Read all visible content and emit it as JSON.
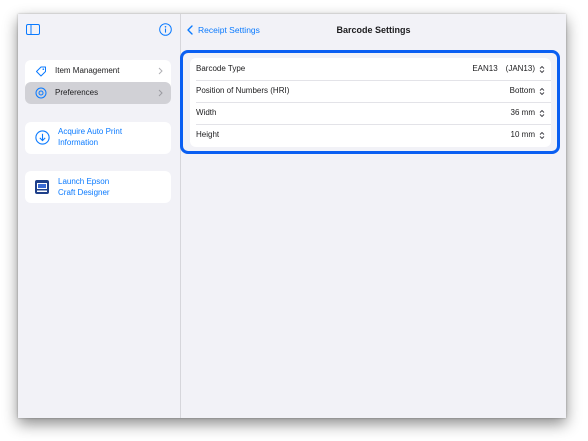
{
  "sidebar": {
    "toggle_icon": "sidebar-toggle-icon",
    "info_icon": "info-icon",
    "menu": [
      {
        "label": "Item Management",
        "icon": "tag-icon",
        "selected": false
      },
      {
        "label": "Preferences",
        "icon": "gear-circle-icon",
        "selected": true
      }
    ],
    "actions": [
      {
        "label_line1": "Acquire Auto Print",
        "label_line2": "Information",
        "icon": "download-circle-icon"
      },
      {
        "label_line1": "Launch Epson",
        "label_line2": "Craft Designer",
        "icon": "epson-app-icon"
      }
    ]
  },
  "nav": {
    "back_label": "Receipt Settings",
    "title": "Barcode Settings"
  },
  "settings": [
    {
      "label": "Barcode Type",
      "value": "EAN13　(JAN13)"
    },
    {
      "label": "Position of Numbers (HRI)",
      "value": "Bottom"
    },
    {
      "label": "Width",
      "value": "36 mm"
    },
    {
      "label": "Height",
      "value": "10 mm"
    }
  ],
  "colors": {
    "accent": "#0a7aff",
    "highlight_border": "#0a5ff2",
    "background": "#f2f2f7",
    "selected_row": "#d1d1d6"
  }
}
